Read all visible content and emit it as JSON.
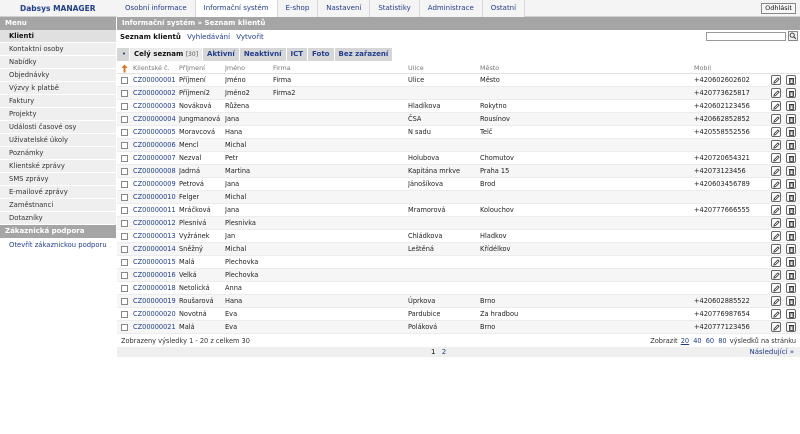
{
  "app": {
    "title": "Dabsys MANAGER",
    "logout": "Odhlásit"
  },
  "nav": {
    "tabs": [
      {
        "label": "Osobní informace"
      },
      {
        "label": "Informační systém"
      },
      {
        "label": "E-shop"
      },
      {
        "label": "Nastavení"
      },
      {
        "label": "Statistiky"
      },
      {
        "label": "Administrace"
      },
      {
        "label": "Ostatní"
      }
    ],
    "active": 1
  },
  "sidebar": {
    "menu_title": "Menu",
    "items": [
      {
        "label": "Klienti"
      },
      {
        "label": "Kontaktní osoby"
      },
      {
        "label": "Nabídky"
      },
      {
        "label": "Objednávky"
      },
      {
        "label": "Výzvy k platbě"
      },
      {
        "label": "Faktury"
      },
      {
        "label": "Projekty"
      },
      {
        "label": "Události časové osy"
      },
      {
        "label": "Uživatelské úkoly"
      },
      {
        "label": "Poznámky"
      },
      {
        "label": "Klientské zprávy"
      },
      {
        "label": "SMS zprávy"
      },
      {
        "label": "E-mailové zprávy"
      },
      {
        "label": "Zaměstnanci"
      },
      {
        "label": "Dotazníky"
      }
    ],
    "support_title": "Zákaznická podpora",
    "support_link": "Otevřít zákaznickou podporu"
  },
  "main": {
    "breadcrumb": "Informační systém » Seznam klientů",
    "title": "Seznam klientů",
    "search_link": "Vyhledávání",
    "create_link": "Vytvořit",
    "search_value": ""
  },
  "filters": {
    "dot": "•",
    "tabs": [
      {
        "label": "Celý seznam",
        "count": "[30]"
      },
      {
        "label": "Aktivní",
        "count": ""
      },
      {
        "label": "Neaktivní",
        "count": ""
      },
      {
        "label": "ICT",
        "count": ""
      },
      {
        "label": "Foto",
        "count": ""
      },
      {
        "label": "Bez zařazení",
        "count": ""
      }
    ]
  },
  "table": {
    "headers": {
      "id": "Klientské č.",
      "last": "Příjmení",
      "first": "Jméno",
      "firm": "Firma",
      "street": "Ulice",
      "city": "Město",
      "mobile": "Mobil"
    },
    "rows": [
      {
        "id": "CZ00000001",
        "last": "Příjmení",
        "first": "Jméno",
        "firm": "Firma",
        "street": "Ulice",
        "city": "Město",
        "mobile": "+420602602602"
      },
      {
        "id": "CZ00000002",
        "last": "Příjmení2",
        "first": "Jméno2",
        "firm": "Firma2",
        "street": "",
        "city": "",
        "mobile": "+420773625817"
      },
      {
        "id": "CZ00000003",
        "last": "Nováková",
        "first": "Růžena",
        "firm": "",
        "street": "Hladíkova",
        "city": "Rokytno",
        "mobile": "+420602123456"
      },
      {
        "id": "CZ00000004",
        "last": "Jungmanová",
        "first": "Jana",
        "firm": "",
        "street": "ČSA",
        "city": "Rousínov",
        "mobile": "+420662852852"
      },
      {
        "id": "CZ00000005",
        "last": "Moravcová",
        "first": "Hana",
        "firm": "",
        "street": "N sadu",
        "city": "Telč",
        "mobile": "+420558552556"
      },
      {
        "id": "CZ00000006",
        "last": "Mencl",
        "first": "Michal",
        "firm": "",
        "street": "",
        "city": "",
        "mobile": ""
      },
      {
        "id": "CZ00000007",
        "last": "Nezval",
        "first": "Petr",
        "firm": "",
        "street": "Holubova",
        "city": "Chomutov",
        "mobile": "+420720654321"
      },
      {
        "id": "CZ00000008",
        "last": "Jadrná",
        "first": "Martina",
        "firm": "",
        "street": "Kapitána mrkve",
        "city": "Praha 15",
        "mobile": "+42073123456"
      },
      {
        "id": "CZ00000009",
        "last": "Petrová",
        "first": "Jana",
        "firm": "",
        "street": "Jánošíkova",
        "city": "Brod",
        "mobile": "+420603456789"
      },
      {
        "id": "CZ00000010",
        "last": "Felger",
        "first": "Michal",
        "firm": "",
        "street": "",
        "city": "",
        "mobile": ""
      },
      {
        "id": "CZ00000011",
        "last": "Mráčková",
        "first": "Jana",
        "firm": "",
        "street": "Mramorová",
        "city": "Kolouchov",
        "mobile": "+420777666555"
      },
      {
        "id": "CZ00000012",
        "last": "Plesnivá",
        "first": "Plesnivka",
        "firm": "",
        "street": "",
        "city": "",
        "mobile": ""
      },
      {
        "id": "CZ00000013",
        "last": "Vyžránek",
        "first": "Jan",
        "firm": "",
        "street": "Chládkova",
        "city": "Hladkov",
        "mobile": ""
      },
      {
        "id": "CZ00000014",
        "last": "Sněžný",
        "first": "Michal",
        "firm": "",
        "street": "Leštěná",
        "city": "Křídélkov",
        "mobile": ""
      },
      {
        "id": "CZ00000015",
        "last": "Malá",
        "first": "Plechovka",
        "firm": "",
        "street": "",
        "city": "",
        "mobile": ""
      },
      {
        "id": "CZ00000016",
        "last": "Velká",
        "first": "Plechovka",
        "firm": "",
        "street": "",
        "city": "",
        "mobile": ""
      },
      {
        "id": "CZ00000018",
        "last": "Netolická",
        "first": "Anna",
        "firm": "",
        "street": "",
        "city": "",
        "mobile": ""
      },
      {
        "id": "CZ00000019",
        "last": "Roušarová",
        "first": "Hana",
        "firm": "",
        "street": "Úprkova",
        "city": "Brno",
        "mobile": "+420602885522"
      },
      {
        "id": "CZ00000020",
        "last": "Novotná",
        "first": "Eva",
        "firm": "",
        "street": "Pardubice",
        "city": "Za hradbou",
        "mobile": "+420776987654"
      },
      {
        "id": "CZ00000021",
        "last": "Malá",
        "first": "Eva",
        "firm": "",
        "street": "Poláková",
        "city": "Brno",
        "mobile": "+420777123456"
      }
    ]
  },
  "footer": {
    "summary": "Zobrazeny výsledky 1 - 20 z celkem 30",
    "show_label": "Zobrazit",
    "page_sizes": [
      "20",
      "40",
      "60",
      "80"
    ],
    "per_page_label": "výsledků na stránku"
  },
  "pager": {
    "pages": [
      "1",
      "2"
    ],
    "current": "1",
    "next": "Následující »"
  },
  "icons": {
    "edit": "pencil-icon",
    "delete": "trash-icon",
    "search": "search-icon",
    "sort": "sort-arrow-icon"
  },
  "colors": {
    "link": "#1f3d8f",
    "header_gray": "#a5a5a5",
    "sort_arrow": "#e0731c"
  }
}
